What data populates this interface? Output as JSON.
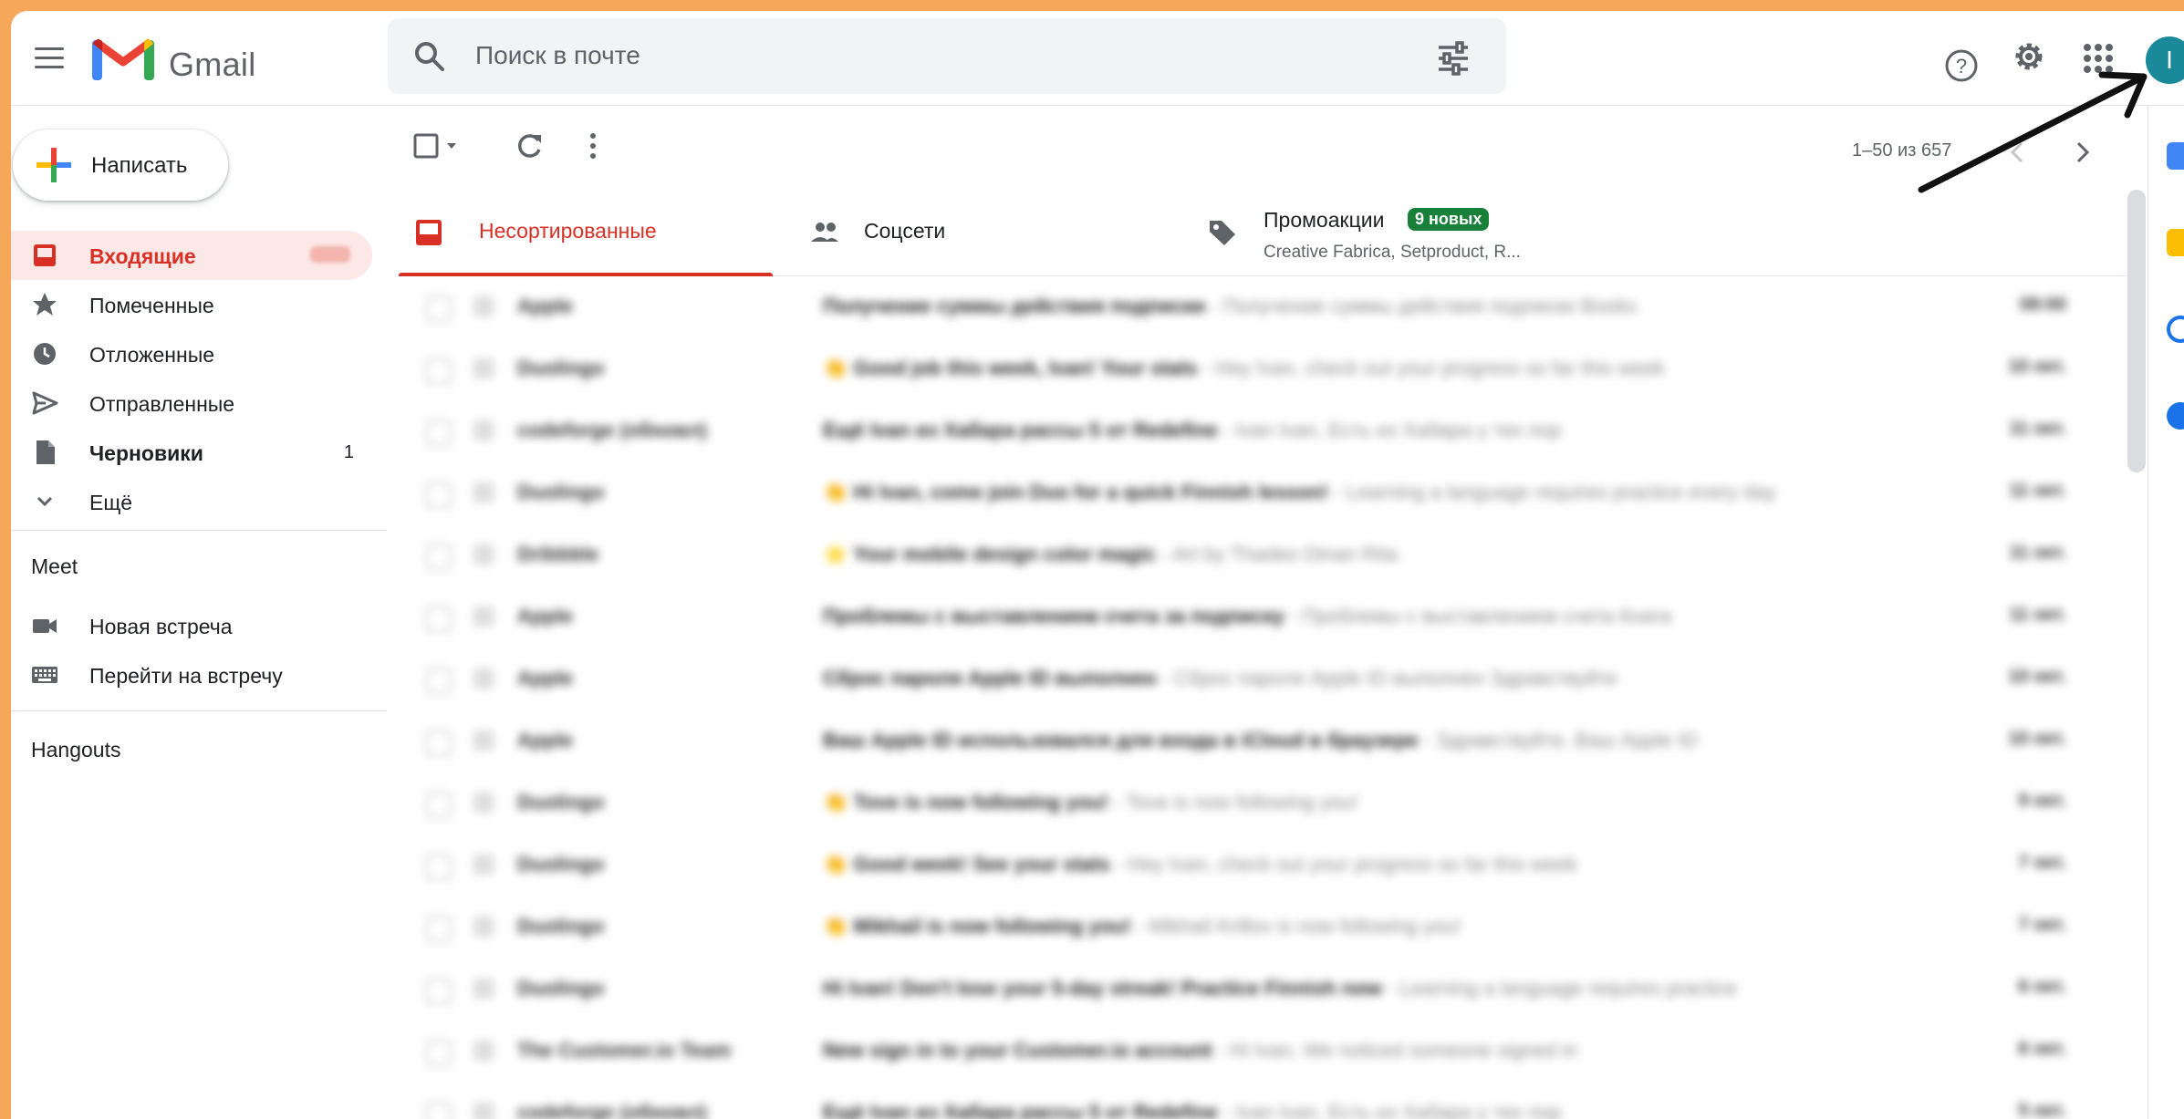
{
  "header": {
    "brand": "Gmail",
    "search_placeholder": "Поиск в почте",
    "avatar_letter": "I"
  },
  "sidebar": {
    "compose_label": "Написать",
    "items": [
      {
        "label": "Входящие",
        "icon": "inbox-icon",
        "active": true
      },
      {
        "label": "Помеченные",
        "icon": "star-icon"
      },
      {
        "label": "Отложенные",
        "icon": "clock-icon"
      },
      {
        "label": "Отправленные",
        "icon": "send-icon"
      },
      {
        "label": "Черновики",
        "icon": "draft-icon",
        "count": "1",
        "bold": true
      },
      {
        "label": "Ещё",
        "icon": "chevron-down-icon"
      }
    ],
    "meet": {
      "title": "Meet",
      "items": [
        {
          "label": "Новая встреча",
          "icon": "video-icon"
        },
        {
          "label": "Перейти на встречу",
          "icon": "keyboard-icon"
        }
      ]
    },
    "hangouts_title": "Hangouts"
  },
  "toolbar": {
    "pager": "1–50 из 657"
  },
  "tabs": [
    {
      "label": "Несортированные",
      "icon": "inbox-tab-icon",
      "active": true
    },
    {
      "label": "Соцсети",
      "icon": "people-icon"
    },
    {
      "label": "Промоакции",
      "icon": "tag-icon",
      "badge": "9 новых",
      "sub": "Creative Fabrica, Setproduct, R..."
    }
  ],
  "emails": [
    {
      "sender": "Apple",
      "subject": "Получение суммы действия подписки",
      "snippet": " - Получение суммы действия подписки Books",
      "date": "08:00"
    },
    {
      "sender": "Duolingo",
      "subject": "👏 Good job this week, Ivan! Your stats",
      "snippet": " - Hey Ivan, check out your progress so far this week",
      "date": "10 окт."
    },
    {
      "sender": "codeforge (обновл)",
      "subject": "Ещё Ivan из Хабара рассы 5 от Redefine",
      "snippet": " - Ivan Ivan, Есть из Хабара у тех пор",
      "date": "11 окт."
    },
    {
      "sender": "Duolingo",
      "subject": "👏 Hi Ivan, come join Duo for a quick Finnish lesson!",
      "snippet": " - Learning a language requires practice every day",
      "date": "11 окт."
    },
    {
      "sender": "Dribbble",
      "subject": "⭐ Your mobile design color magic",
      "snippet": " - Art by Thadeo Dinan Rita",
      "date": "11 окт."
    },
    {
      "sender": "Apple",
      "subject": "Проблемы с выставлением счета за подписку",
      "snippet": " - Проблемы с выставлением счета Книга",
      "date": "11 окт."
    },
    {
      "sender": "Apple",
      "subject": "Сброс пароля Apple ID выполнен",
      "snippet": " - Сброс пароля Apple ID выполнен Здравствуйте",
      "date": "10 окт."
    },
    {
      "sender": "Apple",
      "subject": "Ваш Apple ID использовался для входа в iCloud в браузере",
      "snippet": " - Здравствуйте, Ваш Apple ID",
      "date": "10 окт."
    },
    {
      "sender": "Duolingo",
      "subject": "👏 Tove is now following you!",
      "snippet": " - Tove is now following you!",
      "date": "9 окт."
    },
    {
      "sender": "Duolingo",
      "subject": "👏 Good week! See your stats",
      "snippet": " - Hey Ivan, check out your progress so far this week",
      "date": "7 окт."
    },
    {
      "sender": "Duolingo",
      "subject": "👏 Mikhail is now following you!",
      "snippet": " - Mikhail Krillov is now following you!",
      "date": "7 окт."
    },
    {
      "sender": "Duolingo",
      "subject": "Hi Ivan! Don't lose your 5-day streak! Practice Finnish now",
      "snippet": " - Learning a language requires practice",
      "date": "6 окт."
    },
    {
      "sender": "The Customer.io Team",
      "subject": "New sign in to your Customer.io account",
      "snippet": " - Hi Ivan, We noticed someone signed in",
      "date": "6 окт."
    },
    {
      "sender": "codeforge (обновл)",
      "subject": "Ещё Ivan из Хабара рассы 5 от Redefine",
      "snippet": " - Ivan Ivan, Есть из Хабара у тех пор",
      "date": "5 окт."
    }
  ],
  "colors": {
    "frame": "#F5A85A",
    "accent_red": "#d93025",
    "badge_green": "#188038"
  }
}
